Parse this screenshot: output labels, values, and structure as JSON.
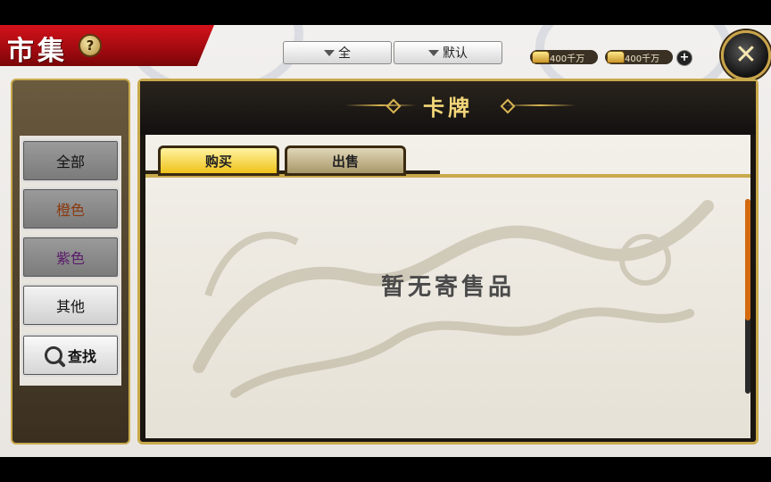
{
  "header": {
    "title": "市集",
    "help_icon": "?",
    "close_icon": "✕"
  },
  "filters": {
    "quality_selected": "全",
    "sort_selected": "默认"
  },
  "currency": {
    "gold_amount": "400千万",
    "silver_amount": "400千万",
    "add_label": "+"
  },
  "sidebar": {
    "items": [
      {
        "label": "全部",
        "color": "#111111"
      },
      {
        "label": "橙色",
        "color": "#8a3a10"
      },
      {
        "label": "紫色",
        "color": "#5a1a6a"
      },
      {
        "label": "其他",
        "color": "#111111"
      }
    ],
    "search_label": "查找"
  },
  "main": {
    "title": "卡牌",
    "tabs": [
      {
        "label": "购买",
        "active": true
      },
      {
        "label": "出售",
        "active": false
      }
    ],
    "empty_message": "暂无寄售品"
  },
  "colors": {
    "accent_gold": "#c8a94c",
    "title_red": "#d4121a",
    "scroll_orange": "#d46a10"
  }
}
